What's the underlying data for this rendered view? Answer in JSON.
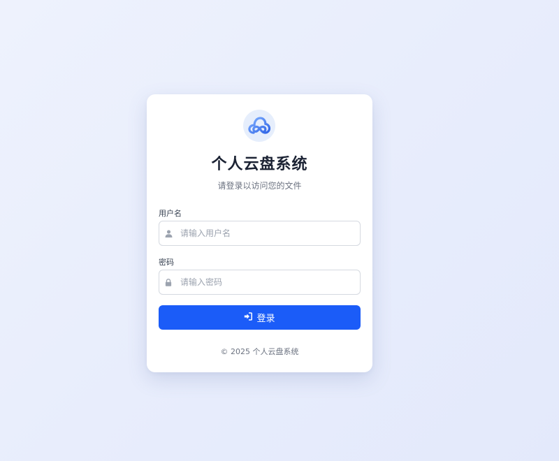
{
  "app": {
    "title": "个人云盘系统",
    "subtitle": "请登录以访问您的文件",
    "logo_icon": "cloud-icon"
  },
  "form": {
    "username": {
      "label": "用户名",
      "placeholder": "请输入用户名",
      "value": "",
      "icon": "user-icon"
    },
    "password": {
      "label": "密码",
      "placeholder": "请输入密码",
      "value": "",
      "icon": "lock-icon"
    },
    "submit": {
      "label": "登录",
      "icon": "sign-in-icon"
    }
  },
  "footer": {
    "text": "© 2025 个人云盘系统"
  },
  "colors": {
    "primary": "#1b5cf8",
    "logo_bg": "#e6eefc",
    "text_dark": "#1b2233",
    "text_muted": "#6b7280"
  }
}
